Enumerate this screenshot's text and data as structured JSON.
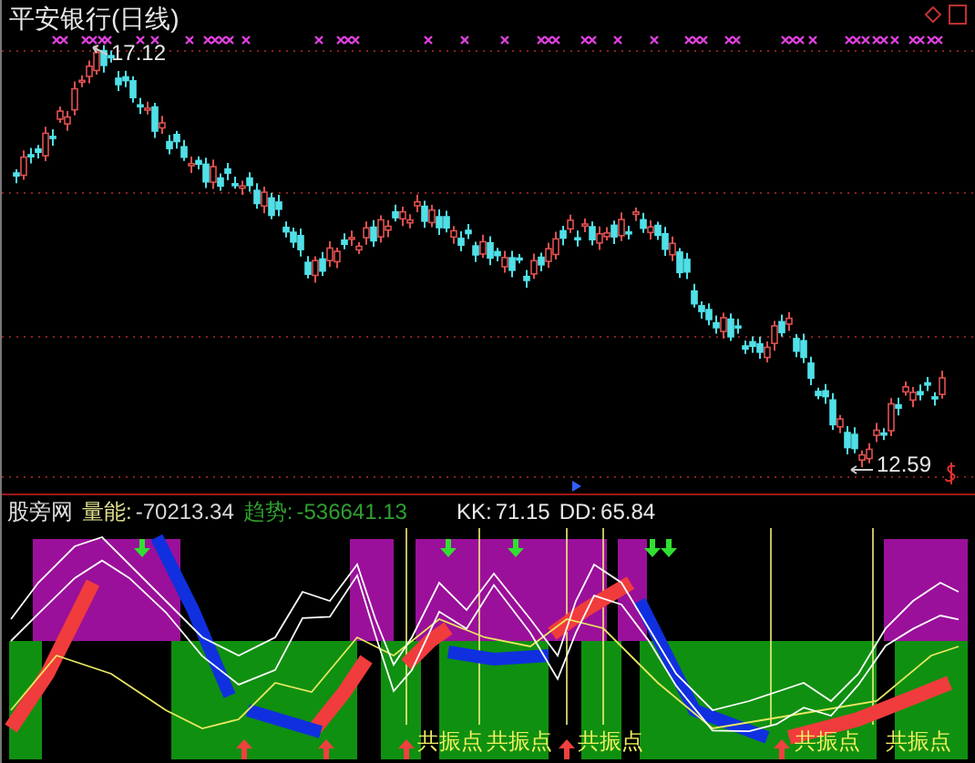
{
  "title": "平安银行(日线)",
  "price_chart": {
    "high_label": "17.12",
    "low_label": "12.59"
  },
  "indicator": {
    "name": "股旁网",
    "readings": [
      {
        "label": "量能:",
        "value": "-70213.34",
        "kind": "volume"
      },
      {
        "label": "趋势:",
        "value": "-536641.13",
        "kind": "trend"
      },
      {
        "label": "KK:",
        "value": "71.15",
        "kind": "plain"
      },
      {
        "label": "DD:",
        "value": "65.84",
        "kind": "plain"
      }
    ],
    "signal_labels": [
      "共振点",
      "共振点",
      "共振点",
      "共振点",
      "共振点"
    ]
  }
}
